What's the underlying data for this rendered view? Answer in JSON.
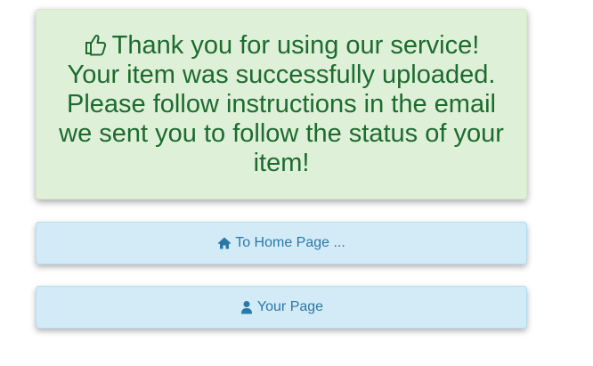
{
  "alert": {
    "line1": "Thank you for using our service!",
    "line2": "Your item was successfully uploaded.",
    "line3": "Please follow instructions in the email",
    "line4": "we sent you to follow the status of your",
    "line5": "item!",
    "icon": "thumbs-up-icon",
    "color": "#1d6b2f",
    "background": "#dff0d8"
  },
  "buttons": {
    "home_label": "To Home Page ...",
    "home_icon": "home-icon",
    "user_label": "Your Page",
    "user_icon": "user-icon",
    "color": "#2a78a8",
    "background": "#d3ebf7"
  }
}
